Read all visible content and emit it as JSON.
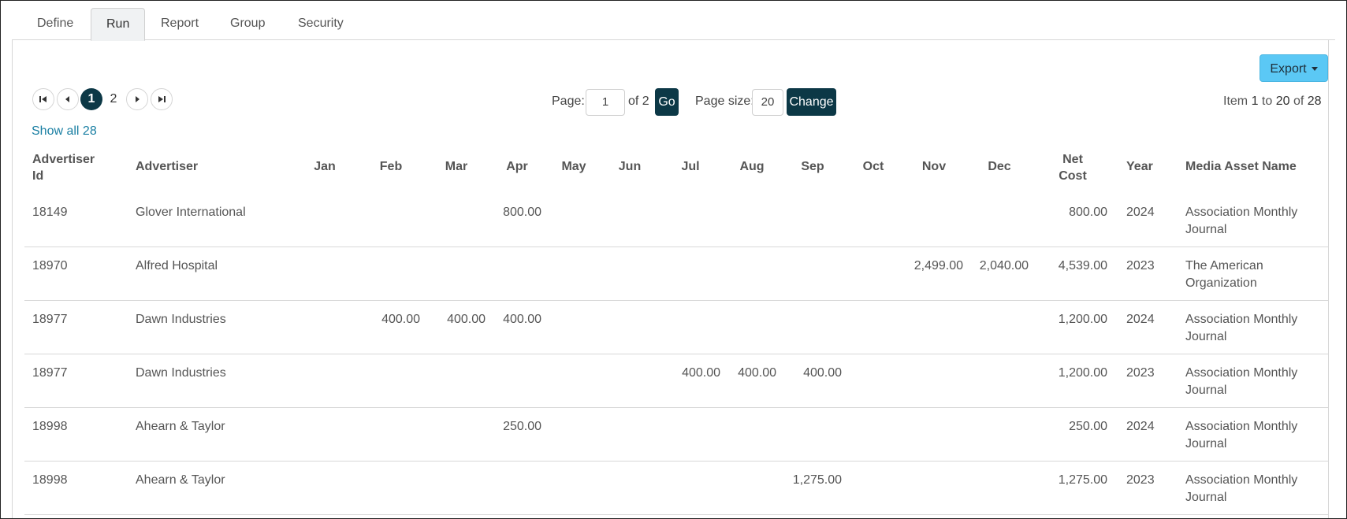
{
  "tabs": [
    "Define",
    "Run",
    "Report",
    "Group",
    "Security"
  ],
  "active_tab": "Run",
  "toolbar": {
    "export_label": "Export"
  },
  "pagination": {
    "pages": [
      "1",
      "2"
    ],
    "current_page": "1",
    "page_label": "Page:",
    "page_value": "1",
    "of_text": "of 2",
    "go_label": "Go",
    "page_size_label": "Page size:",
    "page_size_value": "20",
    "change_label": "Change",
    "item_text_prefix": "Item ",
    "item_from": "1",
    "item_to_text": " to ",
    "item_to": "20",
    "item_of_text": " of ",
    "item_total": "28"
  },
  "show_all_label": "Show all 28",
  "table": {
    "headers": {
      "advertiser_id": [
        "Advertiser",
        "Id"
      ],
      "advertiser": "Advertiser",
      "months": [
        "Jan",
        "Feb",
        "Mar",
        "Apr",
        "May",
        "Jun",
        "Jul",
        "Aug",
        "Sep",
        "Oct",
        "Nov",
        "Dec"
      ],
      "net_cost": [
        "Net",
        "Cost"
      ],
      "year": "Year",
      "media_asset_name": "Media Asset Name"
    },
    "rows": [
      {
        "id": "18149",
        "advertiser": "Glover International",
        "months": [
          "",
          "",
          "",
          "800.00",
          "",
          "",
          "",
          "",
          "",
          "",
          "",
          ""
        ],
        "net": "800.00",
        "year": "2024",
        "media": [
          "Association Monthly",
          "Journal"
        ]
      },
      {
        "id": "18970",
        "advertiser": "Alfred Hospital",
        "months": [
          "",
          "",
          "",
          "",
          "",
          "",
          "",
          "",
          "",
          "",
          "2,499.00",
          "2,040.00"
        ],
        "net": "4,539.00",
        "year": "2023",
        "media": [
          "The American",
          "Organization"
        ]
      },
      {
        "id": "18977",
        "advertiser": "Dawn Industries",
        "months": [
          "",
          "400.00",
          "400.00",
          "400.00",
          "",
          "",
          "",
          "",
          "",
          "",
          "",
          ""
        ],
        "net": "1,200.00",
        "year": "2024",
        "media": [
          "Association Monthly",
          "Journal"
        ]
      },
      {
        "id": "18977",
        "advertiser": "Dawn Industries",
        "months": [
          "",
          "",
          "",
          "",
          "",
          "",
          "400.00",
          "400.00",
          "400.00",
          "",
          "",
          ""
        ],
        "net": "1,200.00",
        "year": "2023",
        "media": [
          "Association Monthly",
          "Journal"
        ]
      },
      {
        "id": "18998",
        "advertiser": "Ahearn & Taylor",
        "months": [
          "",
          "",
          "",
          "250.00",
          "",
          "",
          "",
          "",
          "",
          "",
          "",
          ""
        ],
        "net": "250.00",
        "year": "2024",
        "media": [
          "Association Monthly",
          "Journal"
        ]
      },
      {
        "id": "18998",
        "advertiser": "Ahearn & Taylor",
        "months": [
          "",
          "",
          "",
          "",
          "",
          "",
          "",
          "",
          "1,275.00",
          "",
          "",
          ""
        ],
        "net": "1,275.00",
        "year": "2023",
        "media": [
          "Association Monthly",
          "Journal"
        ]
      }
    ]
  }
}
